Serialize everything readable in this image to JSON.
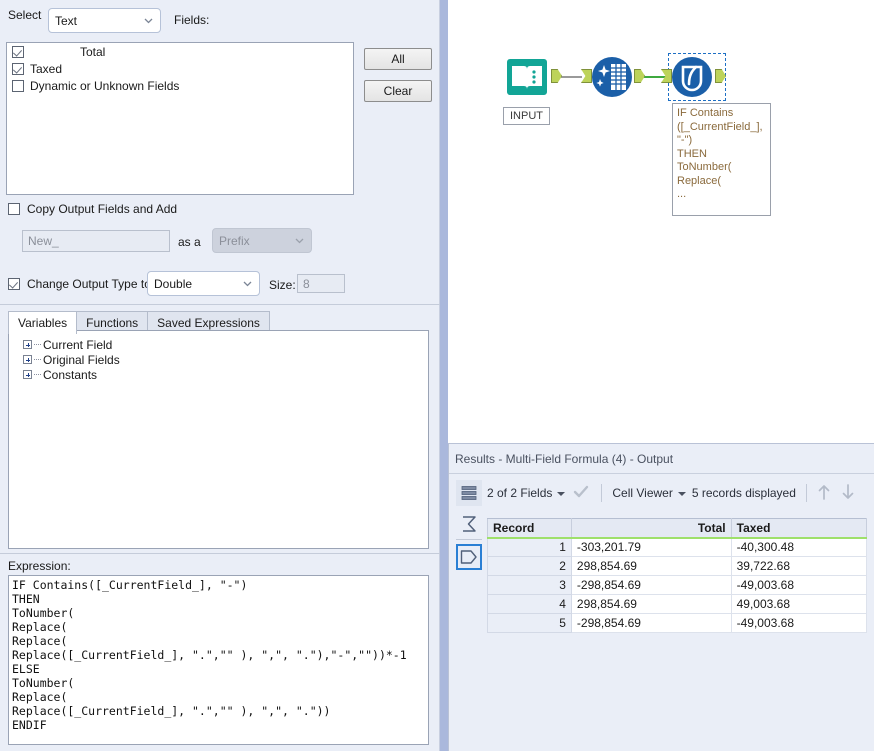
{
  "config": {
    "select_label": "Select",
    "select_value": "Text",
    "fields_label": "Fields:",
    "fields": [
      {
        "label": "Total",
        "checked": true,
        "indented": true
      },
      {
        "label": "Taxed",
        "checked": true,
        "indented": false
      },
      {
        "label": "Dynamic or Unknown Fields",
        "checked": false,
        "indented": false
      }
    ],
    "all_button": "All",
    "clear_button": "Clear",
    "copy_output_label": "Copy Output Fields and Add",
    "copy_output_checked": false,
    "new_field_placeholder": "New_",
    "as_a_label": "as a",
    "prefix_value": "Prefix",
    "change_output_label": "Change Output Type to",
    "change_output_checked": true,
    "output_type_value": "Double",
    "size_label": "Size:",
    "size_value": "8"
  },
  "tabs": [
    {
      "label": "Variables",
      "active": true
    },
    {
      "label": "Functions",
      "active": false
    },
    {
      "label": "Saved Expressions",
      "active": false
    }
  ],
  "tree": [
    {
      "label": "Current Field"
    },
    {
      "label": "Original Fields"
    },
    {
      "label": "Constants"
    }
  ],
  "expression": {
    "label": "Expression:",
    "text": "IF Contains([_CurrentField_], \"-\")\nTHEN\nToNumber(\nReplace(\nReplace(\nReplace([_CurrentField_], \".\",\"\" ), \",\", \".\"),\"-\",\"\"))*-1\nELSE\nToNumber(\nReplace(\nReplace([_CurrentField_], \".\",\"\" ), \",\", \".\"))\nENDIF"
  },
  "canvas": {
    "input_label": "INPUT",
    "annotation_text": "IF Contains\n([_CurrentField_],\n\"-\")\nTHEN\nToNumber(\nReplace(\n...",
    "nodes": [
      {
        "name": "input-data-tool"
      },
      {
        "name": "select-tool"
      },
      {
        "name": "multi-field-formula-tool"
      }
    ]
  },
  "results": {
    "title": "Results - Multi-Field Formula (4) - Output",
    "fields_selector": "2 of 2 Fields",
    "viewer_selector": "Cell Viewer",
    "records_displayed": "5 records displayed",
    "columns": [
      "Record",
      "Total",
      "Taxed"
    ],
    "rows": [
      {
        "record": "1",
        "total": "-303,201.79",
        "taxed": "-40,300.48"
      },
      {
        "record": "2",
        "total": "298,854.69",
        "taxed": "39,722.68"
      },
      {
        "record": "3",
        "total": "-298,854.69",
        "taxed": "-49,003.68"
      },
      {
        "record": "4",
        "total": "298,854.69",
        "taxed": "49,003.68"
      },
      {
        "record": "5",
        "total": "-298,854.69",
        "taxed": "-49,003.68"
      }
    ]
  },
  "colors": {
    "panel_bg": "#eaeef7",
    "splitter": "#aab8dc",
    "accent_green": "#9ee06a",
    "node_blue": "#1b5fa8",
    "node_teal": "#11a394",
    "annotation_text": "#8a6a3c",
    "selection_blue": "#1d6fc4"
  }
}
